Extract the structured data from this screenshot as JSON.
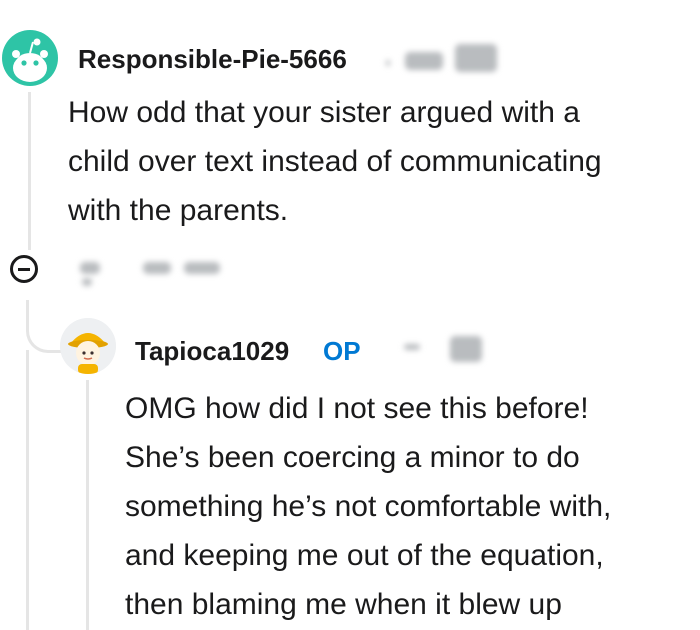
{
  "comment": {
    "username": "Responsible-Pie-5666",
    "avatar_icon": "snoo-avatar-icon",
    "body_lines": [
      "How odd that your sister argued with a",
      "child over text instead of communicating",
      "with the parents."
    ]
  },
  "reply": {
    "username": "Tapioca1029",
    "op_badge": "OP",
    "avatar_icon": "tapioca-avatar-icon",
    "body_lines": [
      "OMG how did I not see this before!",
      "She’s been coercing a minor to do",
      "something he’s not comfortable with,",
      "and keeping me out of the equation,",
      "then blaming me when it blew up"
    ]
  },
  "icons": {
    "collapse": "collapse-minus-icon"
  },
  "colors": {
    "snoo_avatar_bg": "#2ec4a6",
    "op_badge": "#0079d3",
    "thread_line": "#e5e5e5"
  }
}
